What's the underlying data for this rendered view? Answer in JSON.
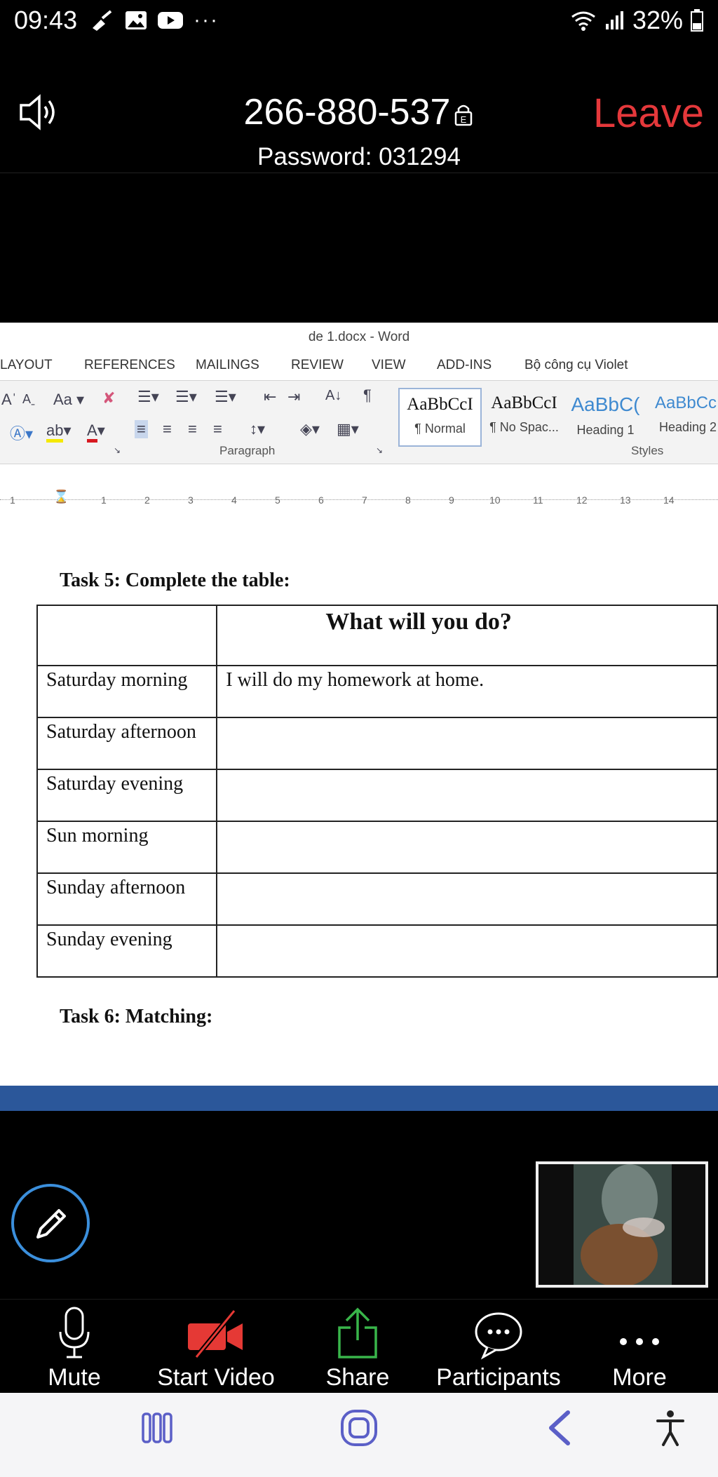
{
  "status_bar": {
    "time": "09:43",
    "more": "···",
    "battery": "32%"
  },
  "meeting": {
    "id": "266-880-537",
    "password_text": "Password: 031294",
    "leave_label": "Leave",
    "lock_badge": "E"
  },
  "word": {
    "title": "de 1.docx - Word",
    "tabs": [
      "LAYOUT",
      "REFERENCES",
      "MAILINGS",
      "REVIEW",
      "VIEW",
      "ADD-INS",
      "Bộ công cụ Violet"
    ],
    "group_labels": {
      "paragraph": "Paragraph",
      "styles": "Styles"
    },
    "styles": [
      {
        "preview": "AaBbCcI",
        "name": "¶ Normal"
      },
      {
        "preview": "AaBbCcI",
        "name": "¶ No Spac..."
      },
      {
        "preview": "AaBbC(",
        "name": "Heading 1"
      },
      {
        "preview": "AaBbCcI",
        "name": "Heading 2"
      }
    ],
    "ribbon_glyphs": {
      "font_size": "Aa",
      "pilcrow": "¶",
      "font_color": "A",
      "highlight": "ab",
      "sort": "A↓"
    },
    "ruler": [
      "1",
      "1",
      "2",
      "3",
      "4",
      "5",
      "6",
      "7",
      "8",
      "9",
      "10",
      "11",
      "12",
      "13",
      "14"
    ]
  },
  "document": {
    "task5_heading": "Task 5: Complete the table:",
    "table_header": "What will you do?",
    "rows": [
      {
        "time": "Saturday morning",
        "answer": "I will do my homework at home."
      },
      {
        "time": "Saturday afternoon",
        "answer": ""
      },
      {
        "time": "Saturday evening",
        "answer": ""
      },
      {
        "time": "Sun morning",
        "answer": ""
      },
      {
        "time": "Sunday afternoon",
        "answer": ""
      },
      {
        "time": "Sunday evening",
        "answer": ""
      }
    ],
    "task6_heading": "Task 6: Matching:"
  },
  "toolbar": {
    "mute_label": "Mute",
    "start_video_label": "Start Video",
    "share_label": "Share",
    "participants_label": "Participants",
    "more_label": "More"
  },
  "colors": {
    "leave": "#e5383b",
    "share_icon": "#39b54a",
    "video_off": "#e53935",
    "annotate_ring": "#3b8fdc",
    "word_blue": "#2b579a"
  }
}
